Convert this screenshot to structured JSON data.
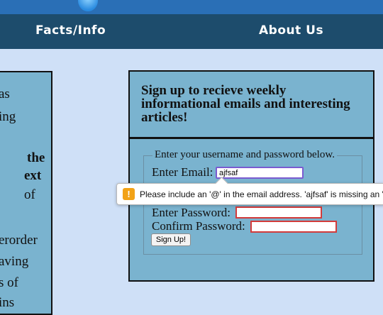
{
  "nav": {
    "items": [
      "Facts/Info",
      "About Us"
    ]
  },
  "left_panel": {
    "fragments": [
      "as",
      "ing",
      "the",
      "ext",
      "of",
      "erorder",
      "aving",
      "s of",
      "ins"
    ]
  },
  "signup": {
    "title": "Sign up to recieve weekly informational emails and interesting articles!",
    "legend": "Enter your username and password below.",
    "email_label": "Enter Email:",
    "email_value": "ajfsaf",
    "password_label": "Enter Password:",
    "confirm_label": "Confirm Password:",
    "submit_label": "Sign Up!"
  },
  "validation": {
    "warning_glyph": "!",
    "message": "Please include an '@' in the email address. 'ajfsaf' is missing an '@'."
  },
  "colors": {
    "nav_bg": "#1d4c6c",
    "page_bg": "#cfe0f7",
    "panel_bg": "#7ab3cf",
    "invalid_border": "#d23b3b",
    "focus_border": "#7a5bd0",
    "warning": "#f2a216"
  }
}
